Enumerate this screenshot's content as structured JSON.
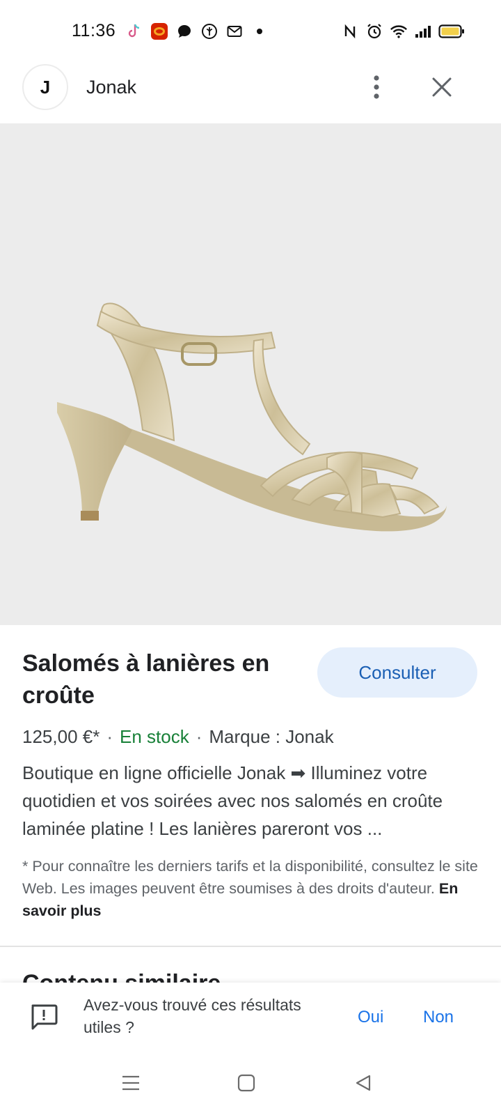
{
  "status_bar": {
    "time": "11:36",
    "left_icons": [
      "tiktok-icon",
      "burger-king-icon",
      "messenger-icon",
      "leaf-icon",
      "mail-icon",
      "dot-icon"
    ],
    "right_icons": [
      "nfc-icon",
      "alarm-icon",
      "wifi-icon",
      "signal-icon",
      "battery-icon"
    ]
  },
  "header": {
    "logo_letter": "J",
    "site_name": "Jonak"
  },
  "product": {
    "image_alt": "sandal-image",
    "title": "Salomés à lanières en croûte",
    "consult_label": "Consulter",
    "price": "125,00 €*",
    "stock": "En stock",
    "brand": "Marque : Jonak",
    "description": "Boutique en ligne officielle Jonak ➡ Illuminez votre quotidien et vos soirées avec nos salomés en croûte laminée platine ! Les lanières pareront vos ...",
    "disclaimer": "* Pour connaître les derniers tarifs et la disponibilité, consultez le site Web. Les images peuvent être soumises à des droits d'auteur.",
    "learn_more": "En savoir plus",
    "similar_title": "Contenu similaire"
  },
  "feedback": {
    "question": "Avez-vous trouvé ces résultats utiles ?",
    "yes": "Oui",
    "no": "Non"
  },
  "colors": {
    "accent": "#1a73e8",
    "consult_bg": "#e5effc",
    "stock_green": "#188038",
    "image_bg": "#ececec"
  }
}
